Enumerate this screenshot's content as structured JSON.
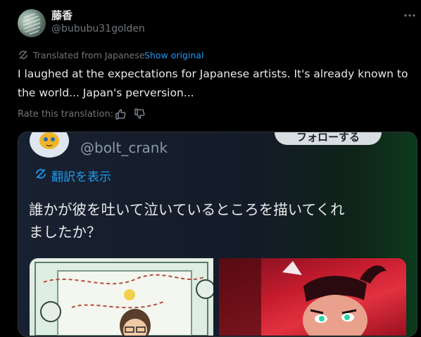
{
  "author": {
    "display_name": "藤香",
    "handle": "@bububu31golden"
  },
  "icons": {
    "more": "more-horizontal-icon",
    "translate": "translate-icon",
    "thumbs_up": "thumbs-up-icon",
    "thumbs_down": "thumbs-down-icon"
  },
  "translation": {
    "label": "Translated from Japanese",
    "show_original": "Show original"
  },
  "tweet": {
    "text": "I laughed at the expectations for Japanese artists. It's already known to the world... Japan's perversion..."
  },
  "rating": {
    "label": "Rate this translation:"
  },
  "media": {
    "quoted_handle": "@bolt_crank",
    "follow_label": "フォローする",
    "translate_label": "翻訳を表示",
    "quoted_text_line1": "誰かが彼を吐いて泣いているところを描いてくれ",
    "quoted_text_line2": "ましたか？"
  },
  "colors": {
    "background": "#000000",
    "text": "#e7e9ea",
    "muted": "#71767b",
    "link": "#1d9bf0"
  }
}
